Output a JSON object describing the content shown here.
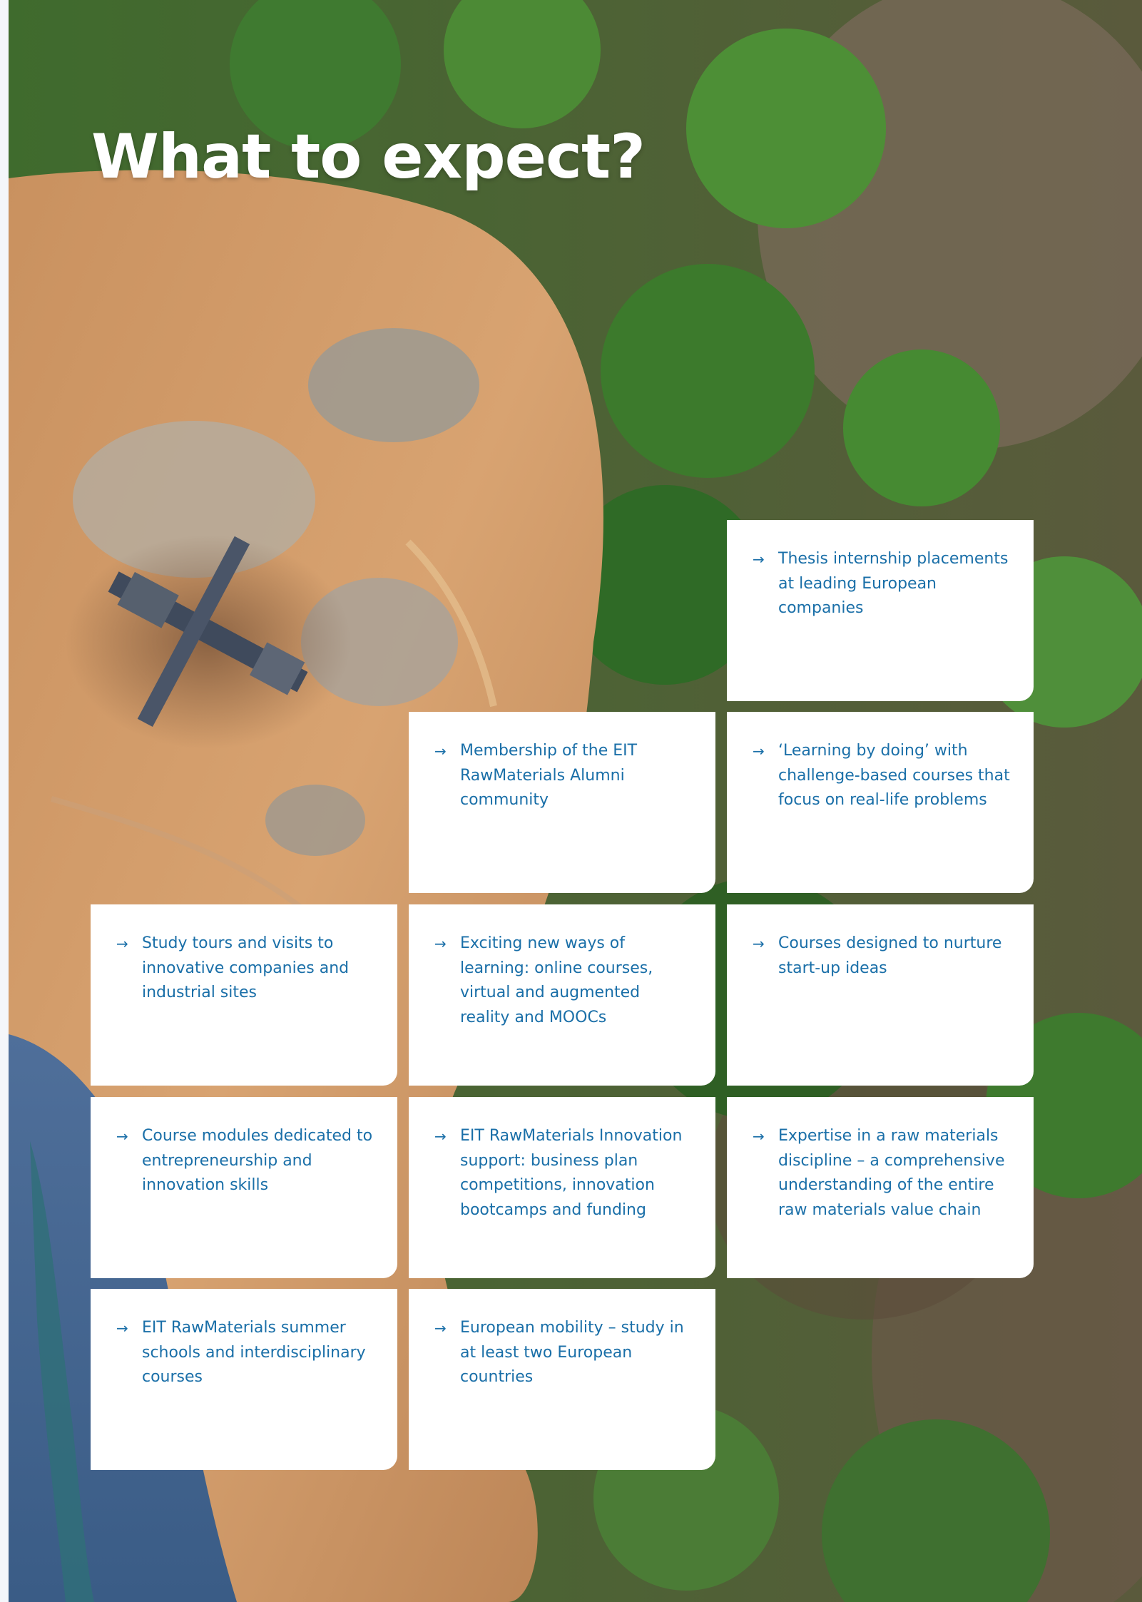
{
  "title": "What to expect?",
  "arrow_icon": "arrow-right-icon",
  "colors": {
    "card_text": "#1a6fa8",
    "card_bg": "#ffffff",
    "title": "#ffffff"
  },
  "cards": [
    {
      "text": "Thesis internship placements at leading European companies"
    },
    {
      "text": "Membership of the EIT RawMaterials Alumni community"
    },
    {
      "text": "‘Learning by doing’ with challenge-based courses that focus on real-life problems"
    },
    {
      "text": "Study tours and visits to innovative companies and industrial sites"
    },
    {
      "text": "Exciting new ways of learning: online courses, virtual and augmented reality and MOOCs"
    },
    {
      "text": "Courses designed to nurture start-up ideas"
    },
    {
      "text": "Course modules dedicated to entrepreneurship and innovation skills"
    },
    {
      "text": "EIT RawMaterials Innovation support: business plan competitions, innovation bootcamps and funding"
    },
    {
      "text": "Expertise in a raw materials discipline – a comprehensive understanding of the entire raw materials value chain"
    },
    {
      "text": "EIT RawMaterials summer schools and interdisciplinary courses"
    },
    {
      "text": "European mobility – study in at least two European countries"
    }
  ]
}
